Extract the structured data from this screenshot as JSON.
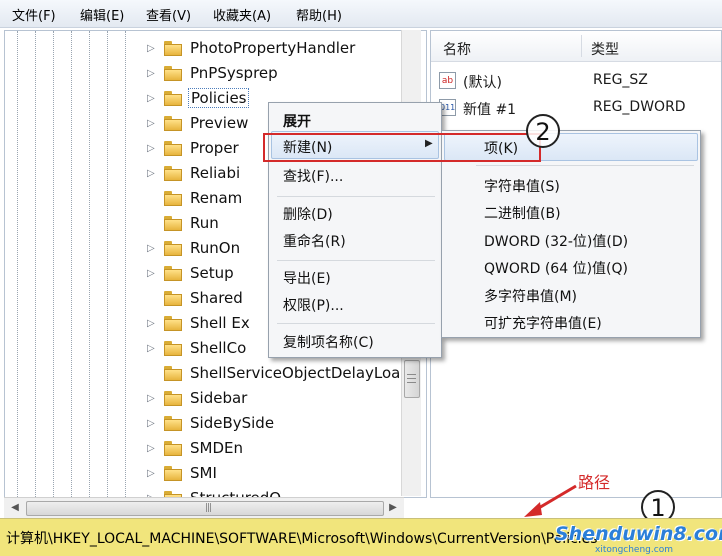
{
  "menubar": {
    "items": [
      "文件(F)",
      "编辑(E)",
      "查看(V)",
      "收藏夹(A)",
      "帮助(H)"
    ]
  },
  "tree": {
    "items": [
      {
        "label": "PhotoPropertyHandler",
        "expandable": true
      },
      {
        "label": "PnPSysprep",
        "expandable": true
      },
      {
        "label": "Policies",
        "expandable": true,
        "selected": true
      },
      {
        "label": "Preview",
        "expandable": true
      },
      {
        "label": "Proper",
        "expandable": true
      },
      {
        "label": "Reliabi",
        "expandable": true
      },
      {
        "label": "Renam",
        "expandable": false
      },
      {
        "label": "Run",
        "expandable": false
      },
      {
        "label": "RunOn",
        "expandable": true
      },
      {
        "label": "Setup",
        "expandable": true
      },
      {
        "label": "Shared",
        "expandable": false
      },
      {
        "label": "Shell Ex",
        "expandable": true
      },
      {
        "label": "ShellCo",
        "expandable": true
      },
      {
        "label": "ShellServiceObjectDelayLoad",
        "expandable": false
      },
      {
        "label": "Sidebar",
        "expandable": true
      },
      {
        "label": "SideBySide",
        "expandable": true
      },
      {
        "label": "SMDEn",
        "expandable": true
      },
      {
        "label": "SMI",
        "expandable": true
      },
      {
        "label": "StructuredQ",
        "expandable": true
      }
    ]
  },
  "values_pane": {
    "col_name": "名称",
    "col_type": "类型",
    "rows": [
      {
        "icon": "string-value-icon",
        "icon_text": "ab",
        "name": "(默认)",
        "type": "REG_SZ"
      },
      {
        "icon": "binary-value-icon",
        "icon_text": "011",
        "name": "新值 #1",
        "type": "REG_DWORD"
      }
    ]
  },
  "context_menu": {
    "expand": "展开",
    "new": "新建(N)",
    "find": "查找(F)...",
    "delete": "删除(D)",
    "rename": "重命名(R)",
    "export": "导出(E)",
    "permissions": "权限(P)...",
    "copy_key_name": "复制项名称(C)"
  },
  "submenu": {
    "key": "项(K)",
    "string": "字符串值(S)",
    "binary": "二进制值(B)",
    "dword": "DWORD (32-位)值(D)",
    "qword": "QWORD (64 位)值(Q)",
    "multi_string": "多字符串值(M)",
    "expandable_string": "可扩充字符串值(E)"
  },
  "annotations": {
    "step1": "1",
    "step2": "2",
    "path_label": "路径",
    "accent_color": "#d42a2a"
  },
  "statusbar": {
    "path": "计算机\\HKEY_LOCAL_MACHINE\\SOFTWARE\\Microsoft\\Windows\\CurrentVersion\\Policies"
  },
  "watermark": {
    "line1": "Shenduwin8.com",
    "line2": "xitongcheng.com"
  }
}
